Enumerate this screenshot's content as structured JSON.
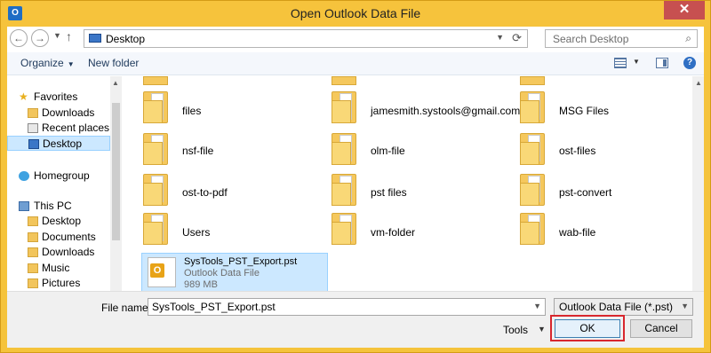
{
  "window": {
    "title": "Open Outlook Data File",
    "close_glyph": "✕",
    "app_glyph": "O"
  },
  "address": {
    "back_glyph": "←",
    "forward_glyph": "→",
    "up_glyph": "↑",
    "location": "Desktop",
    "search_placeholder": "Search Desktop"
  },
  "toolbar": {
    "organize": "Organize",
    "new_folder": "New folder",
    "help_glyph": "?"
  },
  "nav": {
    "items": [
      {
        "label": "Favorites",
        "icon": "star-icon"
      },
      {
        "label": "Downloads",
        "icon": "downloads-folder-icon"
      },
      {
        "label": "Recent places",
        "icon": "recent-places-icon"
      },
      {
        "label": "Desktop",
        "icon": "desktop-icon"
      },
      {
        "label": "Homegroup",
        "icon": "homegroup-icon"
      },
      {
        "label": "This PC",
        "icon": "this-pc-icon"
      },
      {
        "label": "Desktop",
        "icon": "desktop-folder-icon"
      },
      {
        "label": "Documents",
        "icon": "documents-folder-icon"
      },
      {
        "label": "Downloads",
        "icon": "downloads-folder-icon"
      },
      {
        "label": "Music",
        "icon": "music-folder-icon"
      },
      {
        "label": "Pictures",
        "icon": "pictures-folder-icon"
      }
    ]
  },
  "files": [
    {
      "name": "files"
    },
    {
      "name": "jamesmith.systools@gmail.com.ost"
    },
    {
      "name": "MSG Files"
    },
    {
      "name": "nsf-file"
    },
    {
      "name": "olm-file"
    },
    {
      "name": "ost-files"
    },
    {
      "name": "ost-to-pdf"
    },
    {
      "name": "pst files"
    },
    {
      "name": "pst-convert"
    },
    {
      "name": "Users"
    },
    {
      "name": "vm-folder"
    },
    {
      "name": "wab-file"
    }
  ],
  "selected_file": {
    "name": "SysTools_PST_Export.pst",
    "type": "Outlook Data File",
    "size": "989 MB"
  },
  "bottom": {
    "file_name_label": "File name:",
    "file_name_value": "SysTools_PST_Export.pst",
    "file_type": "Outlook Data File (*.pst)",
    "tools": "Tools",
    "ok": "OK",
    "cancel": "Cancel"
  }
}
